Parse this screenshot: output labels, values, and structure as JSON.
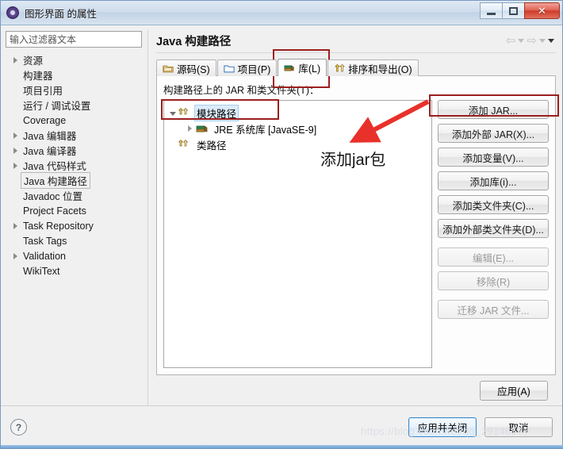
{
  "window": {
    "title": "图形界面 的属性",
    "icon": "properties-icon",
    "controls": {
      "minimize": "minimize-icon",
      "maximize": "maximize-icon",
      "close": "✕"
    }
  },
  "sidebar": {
    "filter": {
      "placeholder": "输入过滤器文本",
      "value": ""
    },
    "items": [
      {
        "label": "资源",
        "expandable": true,
        "selected": false
      },
      {
        "label": "构建器",
        "expandable": false,
        "selected": false
      },
      {
        "label": "项目引用",
        "expandable": false,
        "selected": false
      },
      {
        "label": "运行 / 调试设置",
        "expandable": false,
        "selected": false
      },
      {
        "label": "Coverage",
        "expandable": false,
        "selected": false
      },
      {
        "label": "Java 编辑器",
        "expandable": true,
        "selected": false
      },
      {
        "label": "Java 编译器",
        "expandable": true,
        "selected": false
      },
      {
        "label": "Java 代码样式",
        "expandable": true,
        "selected": false
      },
      {
        "label": "Java 构建路径",
        "expandable": false,
        "selected": true
      },
      {
        "label": "Javadoc 位置",
        "expandable": false,
        "selected": false
      },
      {
        "label": "Project Facets",
        "expandable": false,
        "selected": false
      },
      {
        "label": "Task Repository",
        "expandable": true,
        "selected": false
      },
      {
        "label": "Task Tags",
        "expandable": false,
        "selected": false
      },
      {
        "label": "Validation",
        "expandable": true,
        "selected": false
      },
      {
        "label": "WikiText",
        "expandable": false,
        "selected": false
      }
    ]
  },
  "page": {
    "title": "Java 构建路径",
    "nav": {
      "back": "◅",
      "forward": "▻"
    }
  },
  "tabs": [
    {
      "label": "源码(S)",
      "icon": "source-folder-icon",
      "active": false
    },
    {
      "label": "项目(P)",
      "icon": "project-icon",
      "active": false
    },
    {
      "label": "库(L)",
      "icon": "library-icon",
      "active": true
    },
    {
      "label": "排序和导出(O)",
      "icon": "order-export-icon",
      "active": false
    }
  ],
  "libraries_tab": {
    "list_label": "构建路径上的 JAR 和类文件夹(T)：",
    "tree": [
      {
        "label": "模块路径",
        "icon": "modulepath-icon",
        "indent": 0,
        "state": "expanded",
        "selected": true
      },
      {
        "label": "JRE 系统库 [JavaSE-9]",
        "icon": "library-icon",
        "indent": 1,
        "state": "collapsed",
        "selected": false
      },
      {
        "label": "类路径",
        "icon": "classpath-icon",
        "indent": 0,
        "state": "none",
        "selected": false
      }
    ],
    "buttons": [
      {
        "label": "添加 JAR...",
        "enabled": true,
        "highlighted": true
      },
      {
        "label": "添加外部 JAR(X)...",
        "enabled": true,
        "highlighted": false
      },
      {
        "label": "添加变量(V)...",
        "enabled": true,
        "highlighted": false
      },
      {
        "label": "添加库(i)...",
        "enabled": true,
        "highlighted": false
      },
      {
        "label": "添加类文件夹(C)...",
        "enabled": true,
        "highlighted": false
      },
      {
        "label": "添加外部类文件夹(D)...",
        "enabled": true,
        "highlighted": false
      },
      {
        "label": "编辑(E)...",
        "enabled": false,
        "highlighted": false
      },
      {
        "label": "移除(R)",
        "enabled": false,
        "highlighted": false
      },
      {
        "label": "迁移 JAR 文件...",
        "enabled": false,
        "highlighted": false
      }
    ]
  },
  "apply_button": "应用(A)",
  "footer": {
    "help": "?",
    "apply_and_close": "应用并关闭",
    "cancel": "取消"
  },
  "annotation": {
    "text": "添加jar包",
    "arrow": "red-arrow",
    "color": "#e8312a",
    "box_color": "#9c1f1f"
  },
  "watermark": "https://blog.csdn.net/qq_29146577"
}
